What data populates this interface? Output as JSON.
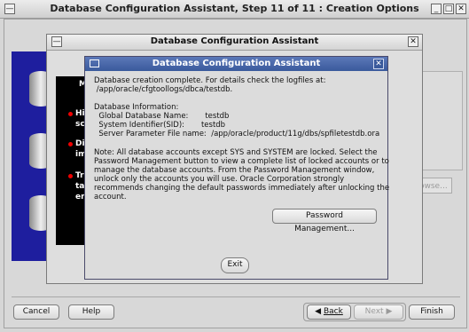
{
  "window": {
    "title": "Database Configuration Assistant, Step 11 of 11 : Creation Options",
    "controls": [
      "minimize",
      "maximize",
      "close"
    ]
  },
  "background": {
    "browse_label": "owse...",
    "left_fragments": [
      "Hi",
      "sc",
      "Di",
      "im",
      "Tr",
      "ta",
      "en",
      "M"
    ]
  },
  "middle_dialog": {
    "title": "Database Configuration Assistant"
  },
  "front_dialog": {
    "title": "Database Configuration Assistant",
    "lines": [
      "Database creation complete. For details check the logfiles at:",
      " /app/oracle/cfgtoollogs/dbca/testdb.",
      "",
      "Database Information:",
      "  Global Database Name:       testdb",
      "  System Identifier(SID):       testdb",
      "  Server Parameter File name:  /app/oracle/product/11g/dbs/spfiletestdb.ora",
      "",
      "Note: All database accounts except SYS and SYSTEM are locked. Select the",
      "Password Management button to view a complete list of locked accounts or to",
      "manage the database accounts. From the Password Management window,",
      "unlock only the accounts you will use. Oracle Corporation strongly",
      "recommends changing the default passwords immediately after unlocking the",
      "account."
    ],
    "password_button": "Password Management...",
    "exit_button": "Exit"
  },
  "footer": {
    "cancel": "Cancel",
    "help": "Help",
    "back": "Back",
    "next": "Next",
    "finish": "Finish"
  },
  "colors": {
    "titlebar_blue": "#3a5a9c",
    "panel_blue": "#1e1e9e",
    "progress_blue": "#0000c8"
  }
}
